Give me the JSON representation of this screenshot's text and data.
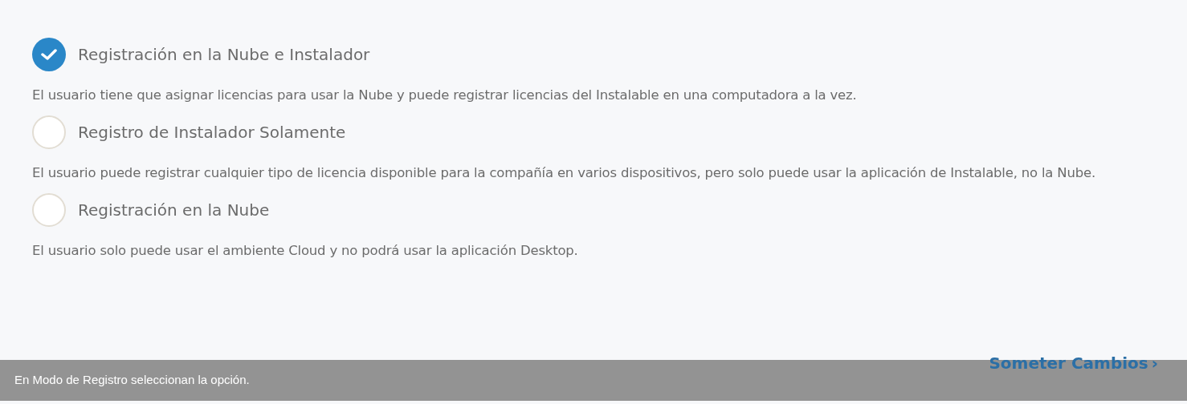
{
  "options": [
    {
      "label": "Registración en la Nube e Instalador",
      "selected": true,
      "description": "El usuario tiene que asignar licencias para usar la Nube y puede registrar licencias del Instalable en una computadora a la vez."
    },
    {
      "label": "Registro de Instalador Solamente",
      "selected": false,
      "description": "El usuario puede registrar cualquier tipo de licencia disponible para la compañía en varios dispositivos, pero solo puede usar la aplicación de Instalable, no la Nube."
    },
    {
      "label": "Registración en la Nube",
      "selected": false,
      "description": "El usuario solo puede usar el ambiente Cloud y no podrá usar la aplicación Desktop."
    }
  ],
  "submit_link": {
    "label": "Someter Cambios",
    "arrow": "›"
  },
  "caption": "En Modo de Registro seleccionan la opción."
}
